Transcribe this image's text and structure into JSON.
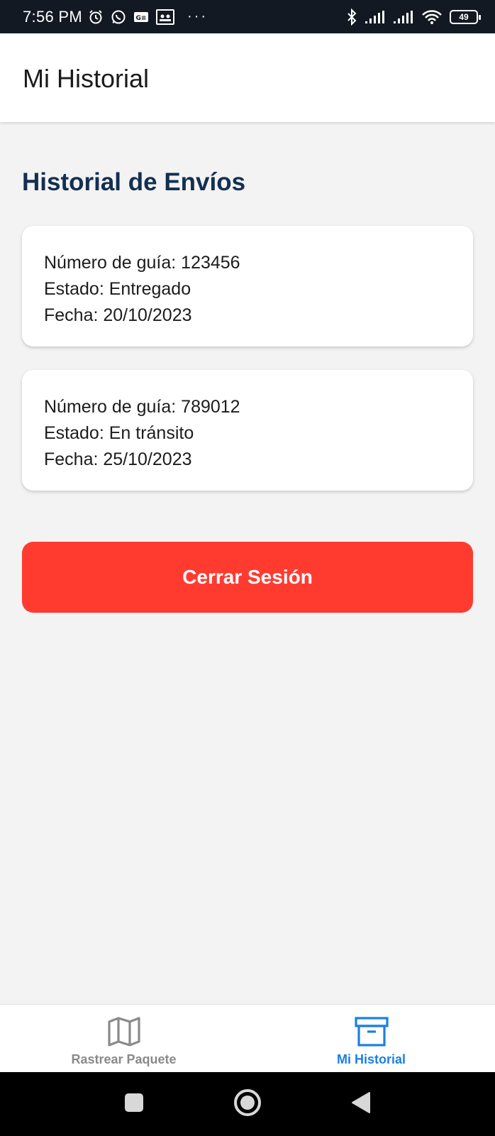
{
  "status_bar": {
    "time": "7:56 PM",
    "dots": "···",
    "battery": "49",
    "icons": [
      "alarm-icon",
      "whatsapp-icon",
      "g-badge-icon",
      "contacts-icon",
      "bluetooth-icon",
      "signal-icon",
      "signal-icon",
      "wifi-icon",
      "battery-icon"
    ]
  },
  "header": {
    "title": "Mi Historial"
  },
  "main": {
    "section_title": "Historial de Envíos",
    "shipments": [
      {
        "guia": "Número de guía: 123456",
        "estado": "Estado: Entregado",
        "fecha": "Fecha: 20/10/2023"
      },
      {
        "guia": "Número de guía: 789012",
        "estado": "Estado: En tránsito",
        "fecha": "Fecha: 25/10/2023"
      }
    ],
    "logout_label": "Cerrar Sesión"
  },
  "tabs": [
    {
      "label": "Rastrear Paquete",
      "icon": "map-icon",
      "active": false
    },
    {
      "label": "Mi Historial",
      "icon": "archive-icon",
      "active": true
    }
  ],
  "colors": {
    "accent": "#1c7fe0",
    "danger": "#ff3b30",
    "title": "#132f52",
    "background": "#f3f3f3"
  }
}
